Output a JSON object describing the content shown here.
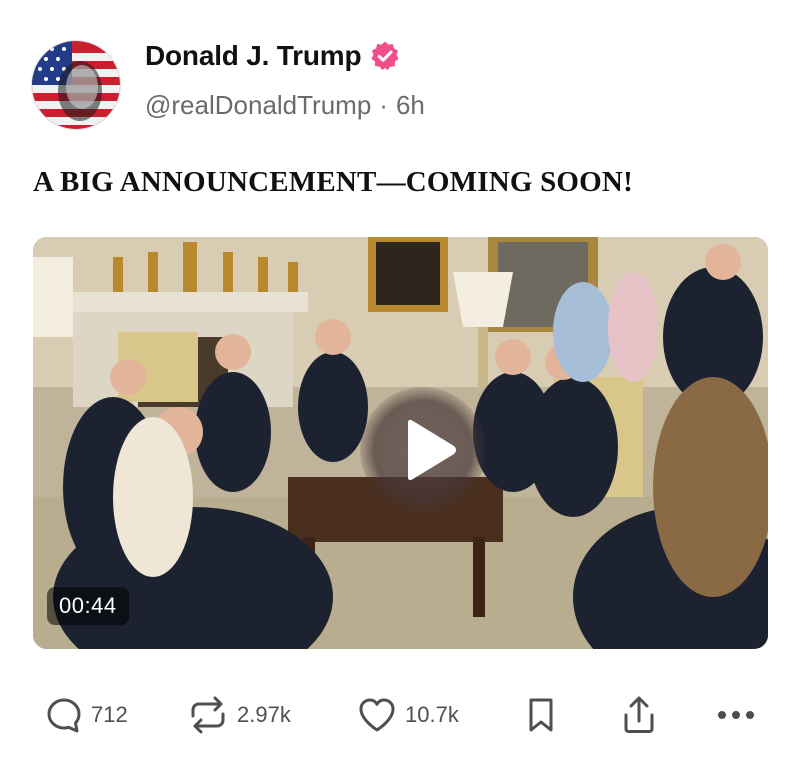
{
  "author": {
    "display_name": "Donald J. Trump",
    "handle": "@realDonaldTrump",
    "separator": "·",
    "time_ago": "6h",
    "verified_color": "#f04e8b"
  },
  "post": {
    "text": "A BIG ANNOUNCEMENT—COMING SOON!"
  },
  "media": {
    "type": "video",
    "duration": "00:44",
    "play_icon": "play-icon"
  },
  "actions": {
    "reply_count": "712",
    "repost_count": "2.97k",
    "like_count": "10.7k",
    "icons": [
      "reply-icon",
      "repost-icon",
      "heart-icon",
      "bookmark-icon",
      "share-icon",
      "more-icon"
    ]
  },
  "colors": {
    "icon_gray": "#4f4f4f",
    "handle_gray": "#6b6b6b"
  }
}
